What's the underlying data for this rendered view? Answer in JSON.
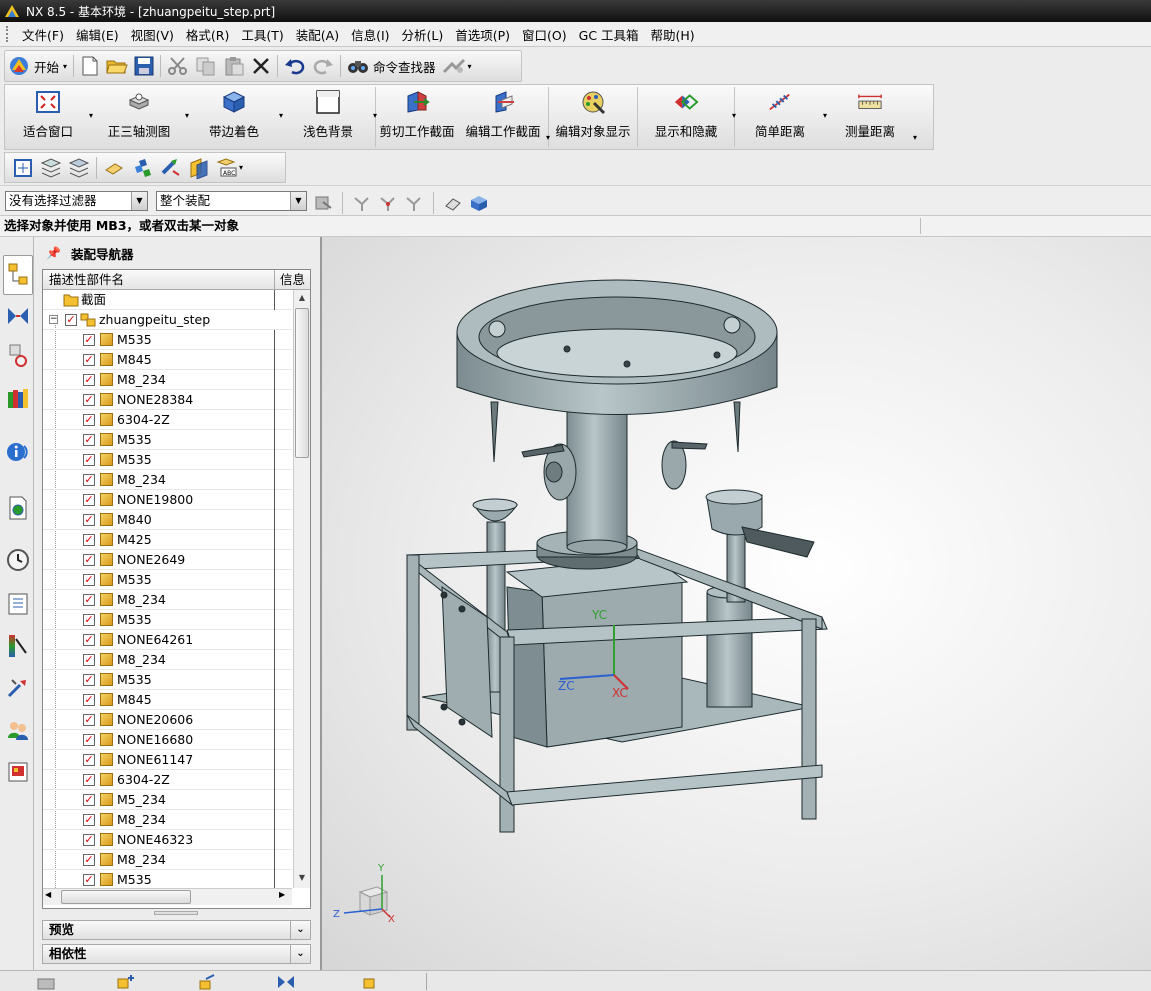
{
  "window": {
    "title": "NX 8.5 - 基本环境 - [zhuangpeitu_step.prt]"
  },
  "menu": [
    "文件(F)",
    "编辑(E)",
    "视图(V)",
    "格式(R)",
    "工具(T)",
    "装配(A)",
    "信息(I)",
    "分析(L)",
    "首选项(P)",
    "窗口(O)",
    "GC 工具箱",
    "帮助(H)"
  ],
  "standard_toolbar": {
    "start_label": "开始",
    "command_finder_label": "命令查找器"
  },
  "big_toolbar": [
    {
      "label": "适合窗口",
      "icon": "fit-window-icon"
    },
    {
      "label": "正三轴测图",
      "icon": "trimetric-view-icon"
    },
    {
      "label": "带边着色",
      "icon": "shaded-edges-icon"
    },
    {
      "label": "浅色背景",
      "icon": "light-background-icon"
    },
    {
      "label": "剪切工作截面",
      "icon": "clip-section-icon"
    },
    {
      "label": "编辑工作截面",
      "icon": "edit-section-icon"
    },
    {
      "label": "编辑对象显示",
      "icon": "edit-object-display-icon"
    },
    {
      "label": "显示和隐藏",
      "icon": "show-hide-icon"
    },
    {
      "label": "简单距离",
      "icon": "simple-distance-icon"
    },
    {
      "label": "测量距离",
      "icon": "measure-distance-icon"
    }
  ],
  "selection_bar": {
    "filter_value": "没有选择过滤器",
    "scope_value": "整个装配"
  },
  "status": {
    "prompt": "选择对象并使用 MB3，或者双击某一对象"
  },
  "navigator": {
    "title": "装配导航器",
    "column_name": "描述性部件名",
    "column_info": "信息",
    "section_node": "截面",
    "root_node": "zhuangpeitu_step",
    "components": [
      "M535",
      "M845",
      "M8_234",
      "NONE28384",
      "6304-2Z",
      "M535",
      "M535",
      "M8_234",
      "NONE19800",
      "M840",
      "M425",
      "NONE2649",
      "M535",
      "M8_234",
      "M535",
      "NONE64261",
      "M8_234",
      "M535",
      "M845",
      "NONE20606",
      "NONE16680",
      "NONE61147",
      "6304-2Z",
      "M5_234",
      "M8_234",
      "NONE46323",
      "M8_234",
      "M535"
    ],
    "preview_label": "预览",
    "dependency_label": "相依性"
  },
  "viewport": {
    "wcs": {
      "y": "YC",
      "z": "ZC",
      "x": "XC"
    },
    "triad": {
      "y": "Y",
      "z": "Z",
      "x": "X"
    }
  },
  "colors": {
    "model": "#a6b5b8",
    "model_dark": "#7d8c90",
    "background": "#e6e6e6",
    "title_bar": "#1a1a1a"
  }
}
